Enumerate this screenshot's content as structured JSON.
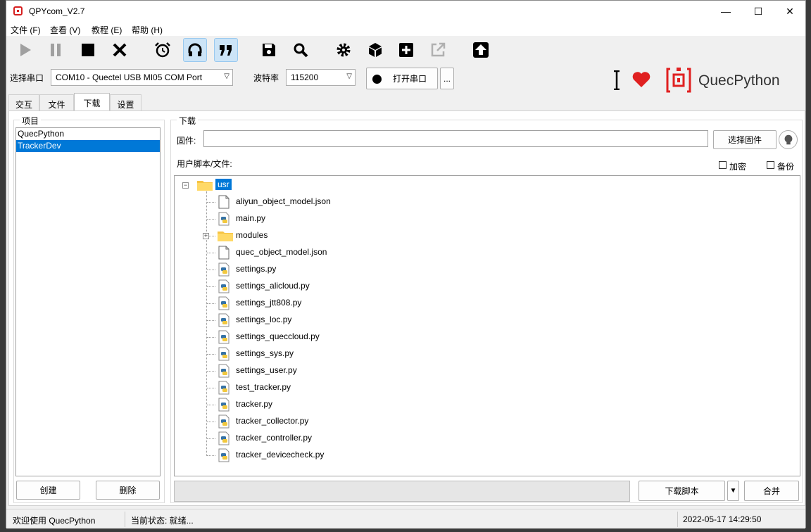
{
  "window": {
    "title": "QPYcom_V2.7",
    "controls": {
      "minimize": "—",
      "maximize": "☐",
      "close": "✕"
    }
  },
  "menu": [
    "文件 (F)",
    "查看 (V)",
    "教程 (E)",
    "帮助 (H)"
  ],
  "toolbar": {
    "icons": [
      "play-icon",
      "pause-icon",
      "stop-icon",
      "close-x-icon",
      "alarm-clock-icon",
      "headset-icon",
      "quote-icon",
      "floppy-save-icon",
      "magnifier-icon",
      "gear-icon",
      "cube-icon",
      "plus-square-icon",
      "external-link-icon",
      "upload-arrow-icon"
    ],
    "active": [
      "headset-icon",
      "quote-icon"
    ]
  },
  "port": {
    "label": "选择串口",
    "value": "COM10 - Quectel USB MI05 COM Port",
    "baud_label": "波特率",
    "baud_value": "115200",
    "open_button": "打开串口",
    "more_button": "..."
  },
  "brand": {
    "name": "QuecPython",
    "accent": "#e02020"
  },
  "tabs": [
    "交互",
    "文件",
    "下载",
    "设置"
  ],
  "active_tab": "下载",
  "left": {
    "group_title": "项目",
    "projects": [
      "QuecPython",
      "TrackerDev"
    ],
    "selected": "TrackerDev",
    "create_button": "创建",
    "delete_button": "删除"
  },
  "download": {
    "group_title": "下载",
    "firmware_label": "固件:",
    "firmware_value": "",
    "choose_firmware_button": "选择固件",
    "scripts_label": "用户脚本/文件:",
    "encrypt_label": "加密",
    "backup_label": "备份",
    "tree_root": "usr",
    "files": [
      {
        "name": "aliyun_object_model.json",
        "type": "file"
      },
      {
        "name": "main.py",
        "type": "python"
      },
      {
        "name": "modules",
        "type": "folder"
      },
      {
        "name": "quec_object_model.json",
        "type": "file"
      },
      {
        "name": "settings.py",
        "type": "python"
      },
      {
        "name": "settings_alicloud.py",
        "type": "python"
      },
      {
        "name": "settings_jtt808.py",
        "type": "python"
      },
      {
        "name": "settings_loc.py",
        "type": "python"
      },
      {
        "name": "settings_queccloud.py",
        "type": "python"
      },
      {
        "name": "settings_sys.py",
        "type": "python"
      },
      {
        "name": "settings_user.py",
        "type": "python"
      },
      {
        "name": "test_tracker.py",
        "type": "python"
      },
      {
        "name": "tracker.py",
        "type": "python"
      },
      {
        "name": "tracker_collector.py",
        "type": "python"
      },
      {
        "name": "tracker_controller.py",
        "type": "python"
      },
      {
        "name": "tracker_devicecheck.py",
        "type": "python"
      }
    ],
    "download_button": "下载脚本",
    "merge_button": "合并",
    "progress": 0
  },
  "status": {
    "welcome": "欢迎使用 QuecPython",
    "state": "当前状态: 就绪...",
    "datetime": "2022-05-17 14:29:50"
  }
}
